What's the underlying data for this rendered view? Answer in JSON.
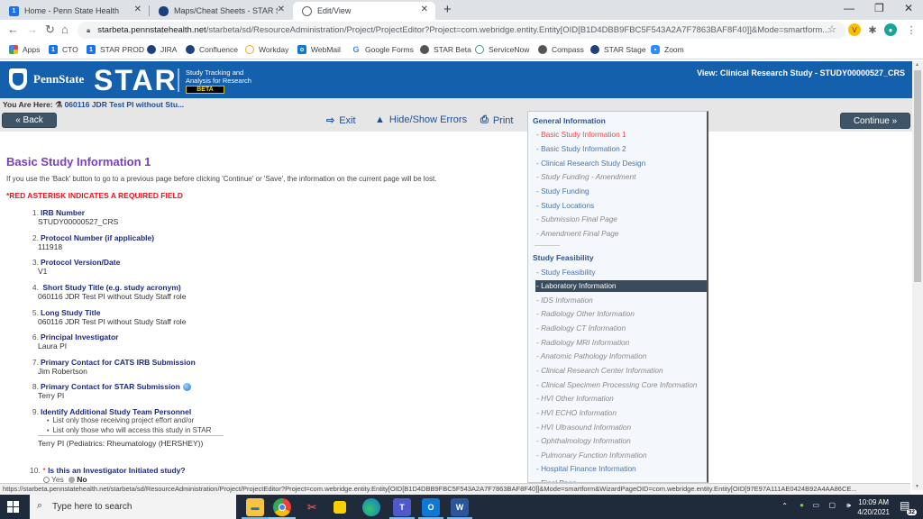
{
  "browser": {
    "tabs": [
      {
        "title": "Home - Penn State Health",
        "icon": "psh-icon",
        "active": false
      },
      {
        "title": "Maps/Cheat Sheets - STAR Suppo",
        "icon": "psu-shield-icon",
        "active": false
      },
      {
        "title": "Edit/View",
        "icon": "globe-icon",
        "active": true
      }
    ],
    "new_tab_label": "+",
    "address": {
      "host": "starbeta.pennstatehealth.net",
      "path": "/starbeta/sd/ResourceAdministration/Project/ProjectEditor?Project=com.webridge.entity.Entity[OID[B1D4DBB9FBC5F543A2A7F7863BAF8F40]]&Mode=smartform..."
    },
    "extensions": [
      "V"
    ],
    "bookmarks": [
      {
        "label": "Apps",
        "icon": "apps-grid-icon",
        "color": "#e8453c"
      },
      {
        "label": "CTO",
        "icon": "psh-icon",
        "color": "#1a73e8"
      },
      {
        "label": "STAR PROD",
        "icon": "psh-icon",
        "color": "#1a73e8"
      },
      {
        "label": "JIRA",
        "icon": "psu-shield-icon",
        "color": "#1e407c"
      },
      {
        "label": "Confluence",
        "icon": "psu-shield-icon",
        "color": "#1e407c"
      },
      {
        "label": "Workday",
        "icon": "workday-icon",
        "color": "#f5a623"
      },
      {
        "label": "WebMail",
        "icon": "outlook-icon",
        "color": "#0f78d4"
      },
      {
        "label": "Google Forms",
        "icon": "google-icon",
        "color": "#4285f4"
      },
      {
        "label": "STAR Beta",
        "icon": "globe-icon",
        "color": "#555"
      },
      {
        "label": "ServiceNow",
        "icon": "servicenow-icon",
        "color": "#3a9e74"
      },
      {
        "label": "Compass",
        "icon": "globe-icon",
        "color": "#555"
      },
      {
        "label": "STAR Stage",
        "icon": "psu-shield-icon",
        "color": "#1e407c"
      },
      {
        "label": "Zoom",
        "icon": "zoom-icon",
        "color": "#2d8cff"
      }
    ]
  },
  "header": {
    "brand": "PennState",
    "app_name": "STAR",
    "tagline_1": "Study Tracking and",
    "tagline_2": "Analysis for Research",
    "badge": "BETA",
    "view_label": "View: Clinical Research Study - STUDY00000527_CRS"
  },
  "breadcrumb": {
    "prefix": "You Are Here:",
    "link": "060116 JDR Test PI without Stu..."
  },
  "toolbar": {
    "back_label": "« Back",
    "exit_label": "Exit",
    "errors_label": "Hide/Show Errors",
    "print_label": "Print",
    "continue_label": "Continue »"
  },
  "main": {
    "title": "Basic Study Information 1",
    "warning": "If you use the 'Back' button to go to a previous page before clicking 'Continue' or 'Save', the information on the current page will be lost.",
    "required_note": "*RED ASTERISK INDICATES A REQUIRED FIELD",
    "questions": [
      {
        "num": "1.",
        "label": "IRB Number",
        "value": "STUDY00000527_CRS"
      },
      {
        "num": "2.",
        "label": "Protocol Number (if applicable)",
        "value": "111918"
      },
      {
        "num": "3.",
        "label": "Protocol Version/Date",
        "value": "V1"
      },
      {
        "num": "4.",
        "label": "Short Study Title (e.g. study acronym)",
        "value": "060116 JDR Test PI without Study Staff role"
      },
      {
        "num": "5.",
        "label": "Long Study Title",
        "value": "060116 JDR Test PI without Study Staff role"
      },
      {
        "num": "6.",
        "label": "Principal Investigator",
        "value": "Laura PI"
      },
      {
        "num": "7.",
        "label": "Primary Contact for CATS IRB Submission",
        "value": "Jim Robertson"
      },
      {
        "num": "8.",
        "label": "Primary Contact for STAR Submission",
        "value": "Terry PI"
      },
      {
        "num": "9.",
        "label": "Identify Additional Study Team Personnel",
        "bullets": [
          "List only those receiving project effort and/or",
          "List only those who will access this study in STAR"
        ],
        "value": "Terry PI (Pediatrics: Rheumatology (HERSHEY))"
      },
      {
        "num": "10.",
        "label": "Is this an Investigator Initiated study?",
        "required": "*",
        "options": [
          "Yes",
          "No"
        ],
        "selected": "No"
      }
    ]
  },
  "nav": {
    "sections": [
      {
        "heading": "General Information",
        "items": [
          {
            "label": "- Basic Study Information 1",
            "state": "current"
          },
          {
            "label": "- Basic Study Information 2",
            "state": "normal"
          },
          {
            "label": "- Clinical Research Study Design",
            "state": "normal"
          },
          {
            "label": "- Study Funding - Amendment",
            "state": "disabled"
          },
          {
            "label": "- Study Funding",
            "state": "normal"
          },
          {
            "label": "- Study Locations",
            "state": "normal"
          },
          {
            "label": "- Submission Final Page",
            "state": "disabled"
          },
          {
            "label": "- Amendment Final Page",
            "state": "disabled"
          }
        ]
      },
      {
        "heading": "Study Feasibility",
        "items": [
          {
            "label": "- Study Feasibility",
            "state": "normal"
          },
          {
            "label": "- Laboratory Information",
            "state": "selected"
          },
          {
            "label": "- IDS Information",
            "state": "disabled"
          },
          {
            "label": "- Radiology Other Information",
            "state": "disabled"
          },
          {
            "label": "- Radiology CT Information",
            "state": "disabled"
          },
          {
            "label": "- Radiology MRI Information",
            "state": "disabled"
          },
          {
            "label": "- Anatomic Pathology Information",
            "state": "disabled"
          },
          {
            "label": "- Clinical Research Center Information",
            "state": "disabled"
          },
          {
            "label": "- Clinical Specimen Processing Core Information",
            "state": "disabled"
          },
          {
            "label": "- HVI Other Information",
            "state": "disabled"
          },
          {
            "label": "- HVI ECHO Information",
            "state": "disabled"
          },
          {
            "label": "- HVI Ultrasound Information",
            "state": "disabled"
          },
          {
            "label": "- Ophthalmology Information",
            "state": "disabled"
          },
          {
            "label": "- Pulmonary Function Information",
            "state": "disabled"
          },
          {
            "label": "- Hospital Finance Information",
            "state": "normal"
          },
          {
            "label": "- Final Page",
            "state": "normal"
          }
        ]
      }
    ]
  },
  "status_bar": {
    "url": "https://starbeta.pennstatehealth.net/starbeta/sd/ResourceAdministration/Project/ProjectEditor?Project=com.webridge.entity.Entity[OID[B1D4DBB9FBC5F543A2A7F7863BAF8F40]]&Mode=smartform&WizardPageOID=com.webridge.entity.Entity[OID[97E97A111AE0424B92A4AA86CE..."
  },
  "taskbar": {
    "search_placeholder": "Type here to search",
    "apps": [
      "file-explorer",
      "chrome",
      "snipping-tool",
      "sticky-notes",
      "edge",
      "teams",
      "outlook",
      "word"
    ],
    "time": "10:09 AM",
    "date": "4/20/2021",
    "notifications": "32"
  },
  "colors": {
    "header_blue": "#1560ac",
    "title_purple": "#7a3fc0",
    "required_red": "#e8141b",
    "label_navy": "#1c2a80",
    "button_slate": "#3d5566"
  }
}
